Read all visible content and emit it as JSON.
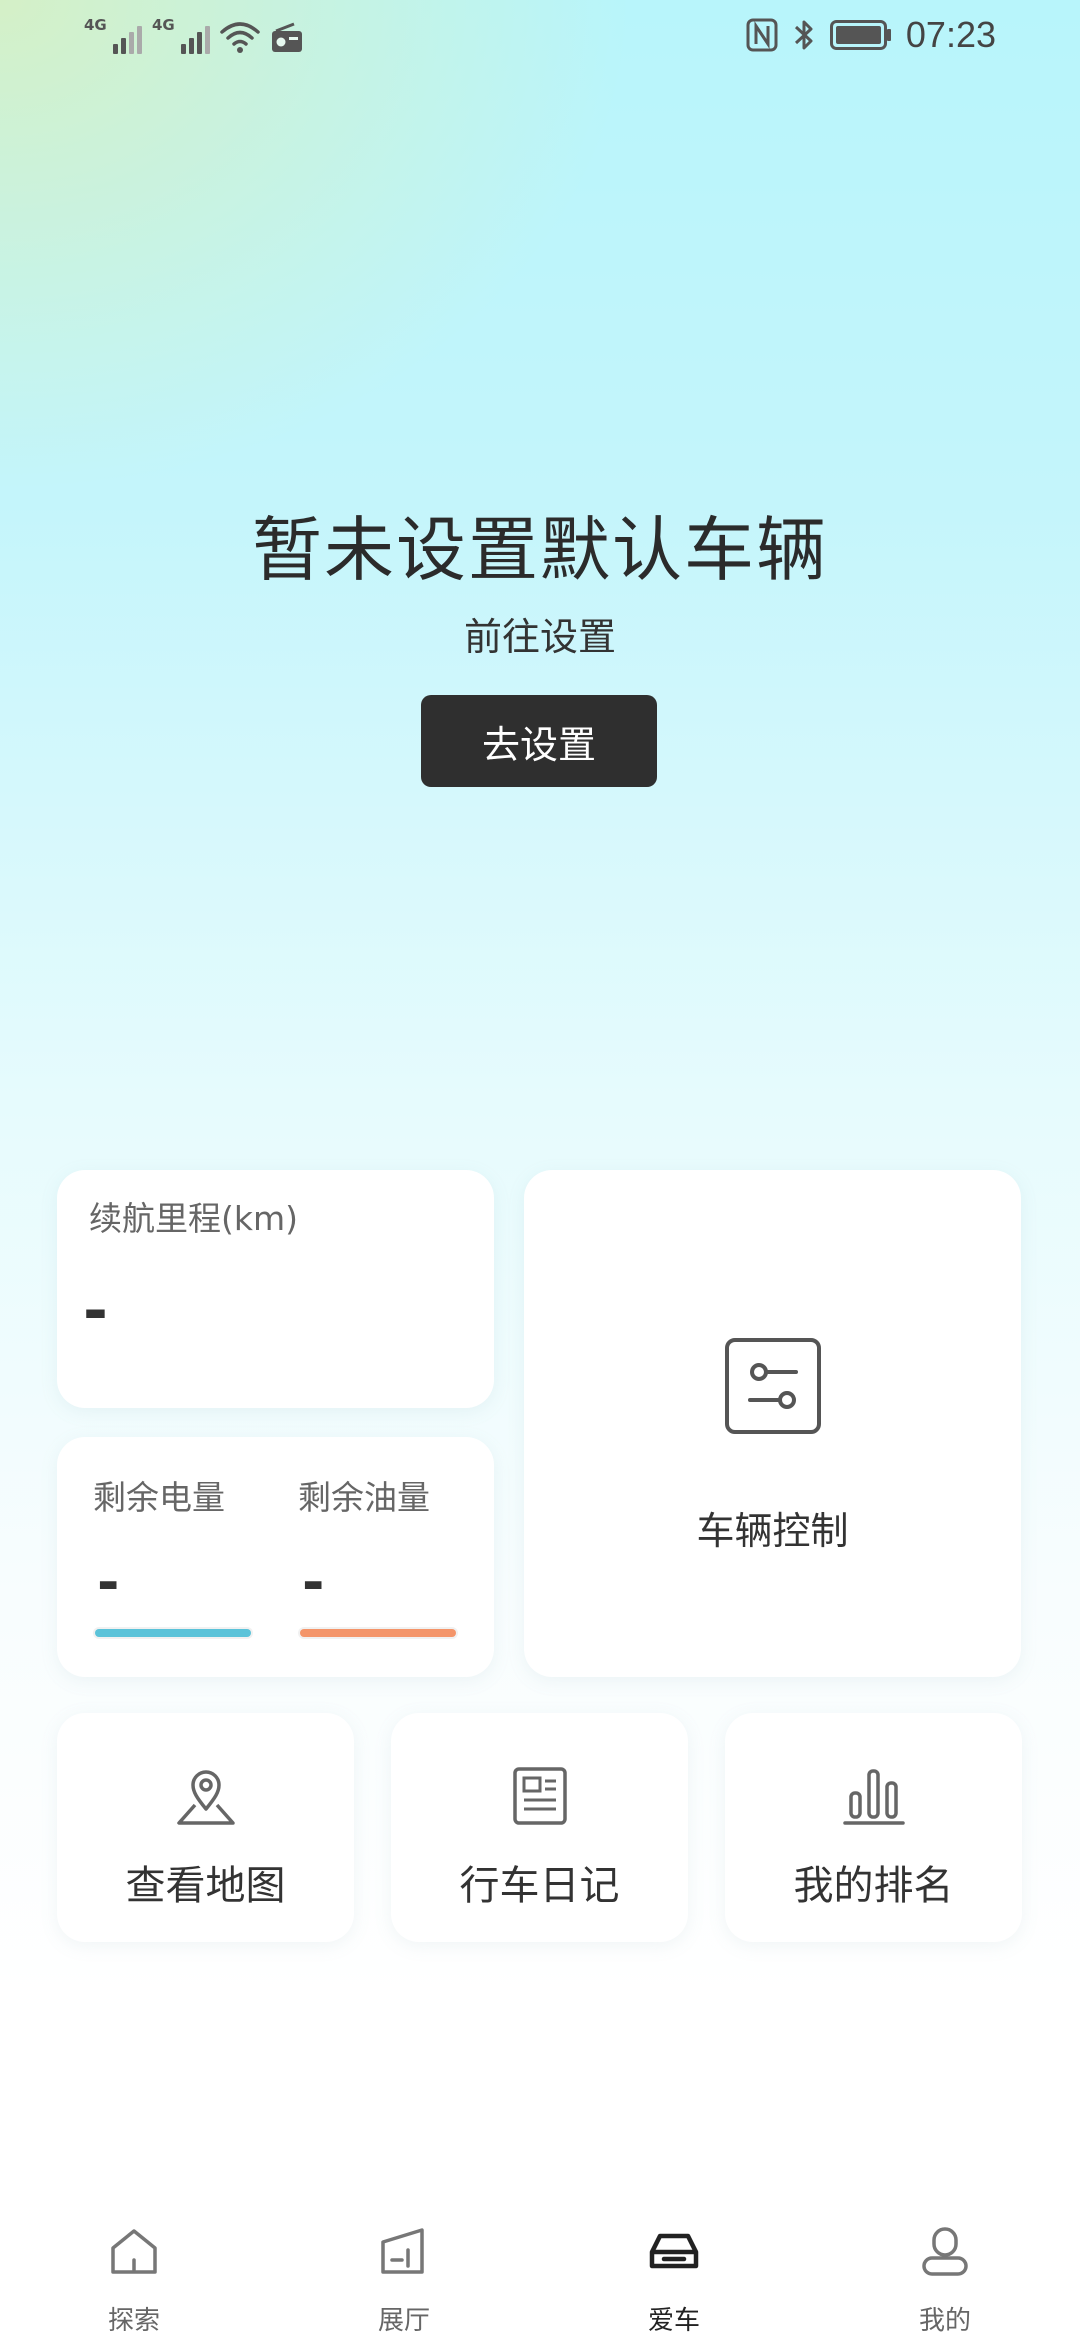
{
  "status_bar": {
    "network1": "4G",
    "network2": "4G",
    "time": "07:23"
  },
  "hero": {
    "title": "暂未设置默认车辆",
    "subtitle": "前往设置",
    "button_label": "去设置"
  },
  "range": {
    "label": "续航里程(km)",
    "value": "-"
  },
  "energy": {
    "battery_label": "剩余电量",
    "battery_value": "-",
    "fuel_label": "剩余油量",
    "fuel_value": "-"
  },
  "vehicle_control": {
    "label": "车辆控制"
  },
  "quick_actions": [
    {
      "label": "查看地图",
      "icon": "map-pin-icon"
    },
    {
      "label": "行车日记",
      "icon": "diary-icon"
    },
    {
      "label": "我的排名",
      "icon": "ranking-chart-icon"
    }
  ],
  "tabs": [
    {
      "label": "探索",
      "icon": "home-icon"
    },
    {
      "label": "展厅",
      "icon": "showroom-icon"
    },
    {
      "label": "爱车",
      "icon": "car-icon",
      "active": true
    },
    {
      "label": "我的",
      "icon": "profile-icon"
    }
  ],
  "colors": {
    "battery_bar": "#5bc3d9",
    "fuel_bar": "#f4956a",
    "primary_button": "#2f2f2f"
  }
}
